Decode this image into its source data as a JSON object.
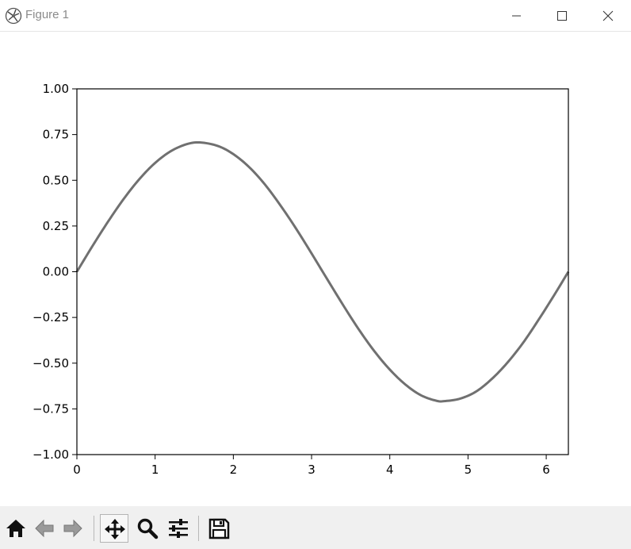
{
  "window": {
    "title": "Figure 1"
  },
  "toolbar": {
    "buttons": [
      {
        "id": "home",
        "icon": "home-icon"
      },
      {
        "id": "back",
        "icon": "back-arrow-icon"
      },
      {
        "id": "forward",
        "icon": "forward-arrow-icon"
      },
      {
        "id": "pan",
        "icon": "pan-move-icon"
      },
      {
        "id": "zoom",
        "icon": "zoom-magnifier-icon"
      },
      {
        "id": "subplots",
        "icon": "configure-subplots-icon"
      },
      {
        "id": "save",
        "icon": "save-floppy-icon"
      }
    ]
  },
  "chart_data": {
    "type": "line",
    "title": "",
    "xlabel": "",
    "ylabel": "",
    "xlim": [
      0,
      6.283
    ],
    "ylim": [
      -1.0,
      1.0
    ],
    "xticks": [
      0,
      1,
      2,
      3,
      4,
      5,
      6
    ],
    "xtick_labels": [
      "0",
      "1",
      "2",
      "3",
      "4",
      "5",
      "6"
    ],
    "yticks": [
      1.0,
      0.75,
      0.5,
      0.25,
      0.0,
      -0.25,
      -0.5,
      -0.75,
      -1.0
    ],
    "ytick_labels": [
      "1.00",
      "0.75",
      "0.50",
      "0.25",
      "0.00",
      "−0.25",
      "−0.50",
      "−0.75",
      "−1.00"
    ],
    "grid": false,
    "series": [
      {
        "color": "#707070",
        "x": [
          0,
          0.2,
          0.4,
          0.6,
          0.8,
          1.0,
          1.2,
          1.4,
          1.571,
          1.8,
          2.0,
          2.2,
          2.4,
          2.6,
          2.8,
          3.0,
          3.142,
          3.4,
          3.6,
          3.8,
          4.0,
          4.2,
          4.4,
          4.6,
          4.712,
          4.9,
          5.1,
          5.3,
          5.5,
          5.7,
          5.9,
          6.1,
          6.283
        ],
        "y": [
          0,
          0.141,
          0.275,
          0.399,
          0.507,
          0.595,
          0.659,
          0.697,
          0.707,
          0.688,
          0.643,
          0.573,
          0.479,
          0.364,
          0.237,
          0.1,
          0,
          -0.18,
          -0.313,
          -0.433,
          -0.535,
          -0.617,
          -0.676,
          -0.706,
          -0.707,
          -0.694,
          -0.656,
          -0.588,
          -0.499,
          -0.391,
          -0.264,
          -0.129,
          0
        ]
      }
    ]
  }
}
